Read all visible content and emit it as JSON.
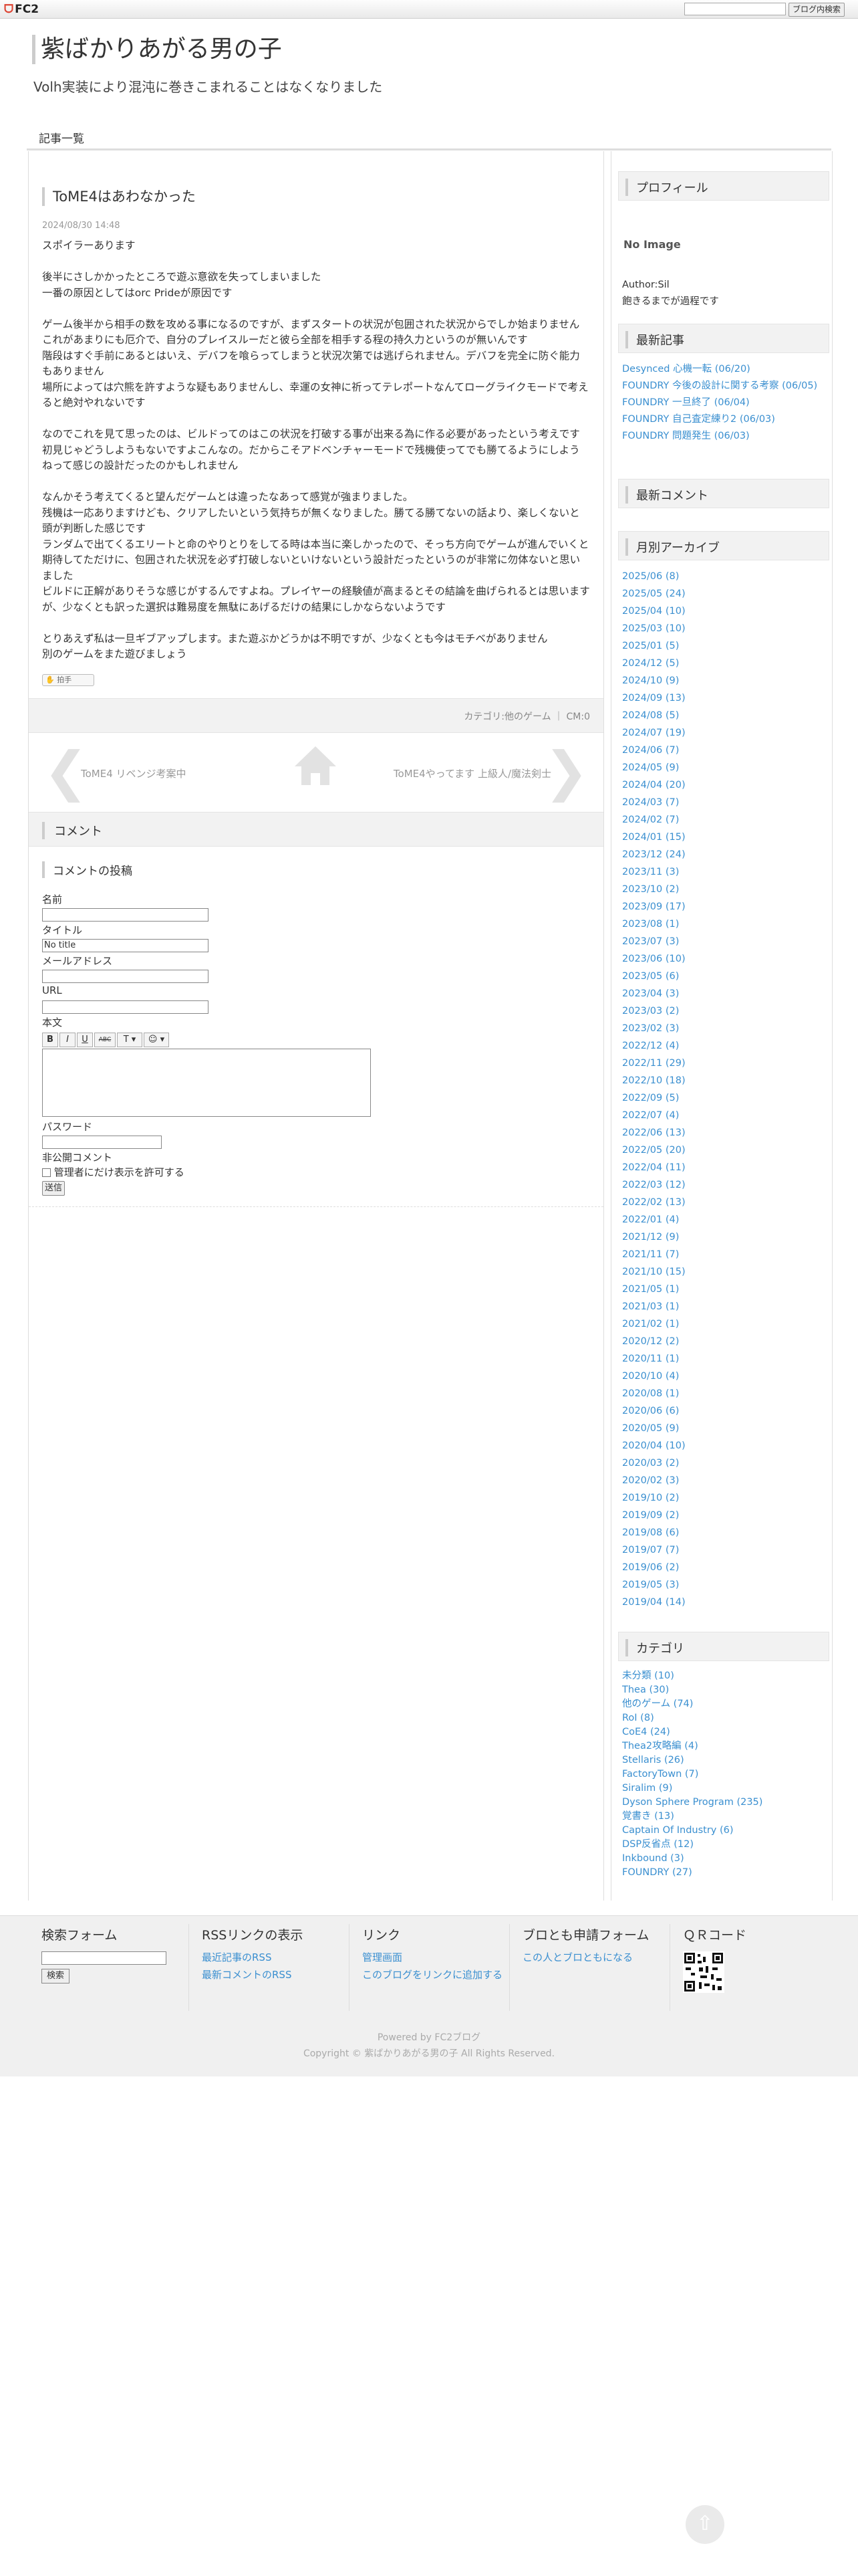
{
  "fc2bar": {
    "logo": "FC2",
    "search_placeholder": "",
    "button": "ブログ内検索"
  },
  "header": {
    "title": "紫ばかりあがる男の子",
    "description": "Volh実装により混沌に巻きこまれることはなくなりました",
    "nav": "記事一覧"
  },
  "article": {
    "title": "ToME4はあわなかった",
    "date": "2024/08/30 14:48",
    "lines": [
      "スポイラーあります",
      "",
      "後半にさしかかったところで遊ぶ意欲を失ってしまいました",
      "一番の原因としてはorc Prideが原因です",
      "",
      "ゲーム後半から相手の数を攻める事になるのですが、まずスタートの状況が包囲された状況からでしか始まりません",
      "これがあまりにも厄介で、自分のプレイスルーだと彼ら全部を相手する程の持久力というのが無いんです",
      "階段はすぐ手前にあるとはいえ、デバフを喰らってしまうと状況次第では逃げられません。デバフを完全に防ぐ能力もありません",
      "場所によっては穴熊を許すような疑もありませんし、幸運の女神に祈ってテレポートなんてローグライクモードで考えると絶対やれないです",
      "",
      "なのでこれを見て思ったのは、ビルドってのはこの状況を打破する事が出来る為に作る必要があったという考えです",
      "初見じゃどうしようもないですよこんなの。だからこそアドベンチャーモードで残機使ってでも勝てるようにしようねって感じの設計だったのかもしれません",
      "",
      "なんかそう考えてくると望んだゲームとは違ったなあって感覚が強まりました。",
      "残機は一応ありますけども、クリアしたいという気持ちが無くなりました。勝てる勝てないの話より、楽しくないと頭が判断した感じです",
      "ランダムで出てくるエリートと命のやりとりをしてる時は本当に楽しかったので、そっち方向でゲームが進んでいくと期待してただけに、包囲された状況を必ず打破しないといけないという設計だったというのが非常に勿体ないと思いました",
      "ビルドに正解がありそうな感じがするんですよね。プレイヤーの経験値が高まるとその結論を曲げられるとは思いますが、少なくとも訳った選択は難易度を無駄にあげるだけの結果にしかならないようです",
      "",
      "とりあえず私は一旦ギブアップします。また遊ぶかどうかは不明ですが、少なくとも今はモチベがありません",
      "別のゲームをまた遊びましょう"
    ],
    "clap": "拍手",
    "category_text": "カテゴリ:他のゲーム ｜ CM:0",
    "prev": "ToME4 リベンジ考案中",
    "next": "ToME4やってます 上級人/魔法剣士"
  },
  "comment": {
    "heading": "コメント",
    "form_title": "コメントの投稿",
    "labels": {
      "name": "名前",
      "title": "タイトル",
      "email": "メールアドレス",
      "url": "URL",
      "body": "本文",
      "password": "パスワード",
      "secret": "非公開コメント",
      "secret_check": "管理者にだけ表示を許可する"
    },
    "title_value": "No title",
    "toolbar": [
      "B",
      "I",
      "U",
      "ABC",
      "T ▾",
      "☺ ▾"
    ],
    "submit": "送信"
  },
  "sidebar": {
    "profile": {
      "heading": "プロフィール",
      "noimage": "No Image",
      "author": "Author:Sil",
      "note": "飽きるまでが過程です"
    },
    "recent": {
      "heading": "最新記事",
      "items": [
        "Desynced  心機一転 (06/20)",
        "FOUNDRY  今後の設計に関する考察 (06/05)",
        "FOUNDRY  一旦終了 (06/04)",
        "FOUNDRY  自己査定練り2 (06/03)",
        "FOUNDRY  問題発生 (06/03)"
      ]
    },
    "comments": {
      "heading": "最新コメント"
    },
    "archive": {
      "heading": "月別アーカイブ",
      "items": [
        "2025/06 (8)",
        "2025/05 (24)",
        "2025/04 (10)",
        "2025/03 (10)",
        "2025/01 (5)",
        "2024/12 (5)",
        "2024/10 (9)",
        "2024/09 (13)",
        "2024/08 (5)",
        "2024/07 (19)",
        "2024/06 (7)",
        "2024/05 (9)",
        "2024/04 (20)",
        "2024/03 (7)",
        "2024/02 (7)",
        "2024/01 (15)",
        "2023/12 (24)",
        "2023/11 (3)",
        "2023/10 (2)",
        "2023/09 (17)",
        "2023/08 (1)",
        "2023/07 (3)",
        "2023/06 (10)",
        "2023/05 (6)",
        "2023/04 (3)",
        "2023/03 (2)",
        "2023/02 (3)",
        "2022/12 (4)",
        "2022/11 (29)",
        "2022/10 (18)",
        "2022/09 (5)",
        "2022/07 (4)",
        "2022/06 (13)",
        "2022/05 (20)",
        "2022/04 (11)",
        "2022/03 (12)",
        "2022/02 (13)",
        "2022/01 (4)",
        "2021/12 (9)",
        "2021/11 (7)",
        "2021/10 (15)",
        "2021/05 (1)",
        "2021/03 (1)",
        "2021/02 (1)",
        "2020/12 (2)",
        "2020/11 (1)",
        "2020/10 (4)",
        "2020/08 (1)",
        "2020/06 (6)",
        "2020/05 (9)",
        "2020/04 (10)",
        "2020/03 (2)",
        "2020/02 (3)",
        "2019/10 (2)",
        "2019/09 (2)",
        "2019/08 (6)",
        "2019/07 (7)",
        "2019/06 (2)",
        "2019/05 (3)",
        "2019/04 (14)"
      ]
    },
    "category": {
      "heading": "カテゴリ",
      "items": [
        "未分類 (10)",
        "Thea (30)",
        "他のゲーム (74)",
        "RoI (8)",
        "CoE4 (24)",
        "Thea2攻略編 (4)",
        "Stellaris (26)",
        "FactoryTown (7)",
        "Siralim (9)",
        "Dyson Sphere Program (235)",
        "覚書き (13)",
        "Captain Of Industry (6)",
        "DSP反省点 (12)",
        "Inkbound (3)",
        "FOUNDRY (27)"
      ]
    }
  },
  "footer": {
    "search": {
      "heading": "検索フォーム",
      "button": "検索"
    },
    "rss": {
      "heading": "RSSリンクの表示",
      "links": [
        "最近記事のRSS",
        "最新コメントのRSS"
      ]
    },
    "links": {
      "heading": "リンク",
      "items": [
        "管理画面",
        "このブログをリンクに追加する"
      ]
    },
    "friend": {
      "heading": "ブロとも申請フォーム",
      "link": "この人とブロともになる"
    },
    "qr": {
      "heading": "ＱＲコード"
    },
    "powered": "Powered by FC2ブログ",
    "copyright": "Copyright © 紫ばかりあがる男の子 All Rights Reserved."
  }
}
